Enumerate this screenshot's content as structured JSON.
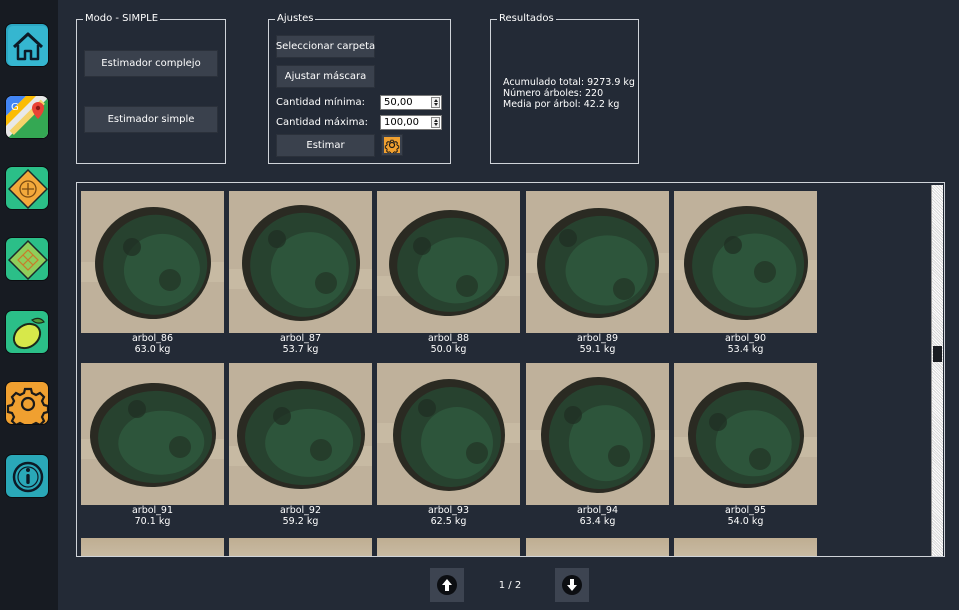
{
  "sidebar": {
    "items": [
      {
        "name": "home",
        "icon": "home-icon"
      },
      {
        "name": "maps",
        "icon": "maps-icon"
      },
      {
        "name": "add-area",
        "icon": "add-area-icon"
      },
      {
        "name": "grid-area",
        "icon": "grid-area-icon"
      },
      {
        "name": "lemon",
        "icon": "lemon-icon"
      },
      {
        "name": "settings",
        "icon": "gear-icon"
      },
      {
        "name": "info",
        "icon": "info-icon"
      }
    ]
  },
  "mode": {
    "title": "Modo - SIMPLE",
    "complex_label": "Estimador complejo",
    "simple_label": "Estimador simple"
  },
  "settings": {
    "title": "Ajustes",
    "select_folder_label": "Seleccionar carpeta",
    "adjust_mask_label": "Ajustar máscara",
    "min_label": "Cantidad mínima:",
    "min_value": "50,00",
    "max_label": "Cantidad máxima:",
    "max_value": "100,00",
    "estimate_label": "Estimar"
  },
  "results": {
    "title": "Resultados",
    "total": "Acumulado total: 9273.9 kg",
    "count": "Número árboles: 220",
    "mean": "Media por árbol: 42.2 kg"
  },
  "gallery": {
    "items": [
      {
        "name": "arbol_86",
        "weight": "63.0 kg"
      },
      {
        "name": "arbol_87",
        "weight": "53.7 kg"
      },
      {
        "name": "arbol_88",
        "weight": "50.0 kg"
      },
      {
        "name": "arbol_89",
        "weight": "59.1 kg"
      },
      {
        "name": "arbol_90",
        "weight": "53.4 kg"
      },
      {
        "name": "arbol_91",
        "weight": "70.1 kg"
      },
      {
        "name": "arbol_92",
        "weight": "59.2 kg"
      },
      {
        "name": "arbol_93",
        "weight": "62.5 kg"
      },
      {
        "name": "arbol_94",
        "weight": "63.4 kg"
      },
      {
        "name": "arbol_95",
        "weight": "54.0 kg"
      }
    ]
  },
  "pager": {
    "indicator": "1 / 2",
    "prev_icon": "arrow-up-icon",
    "next_icon": "arrow-down-icon"
  },
  "colors": {
    "background": "#232a36",
    "sidebar": "#171b22",
    "button": "#3a414d",
    "accent_teal": "#2aa8b8",
    "accent_orange": "#f0a030",
    "accent_green": "#7cc84a"
  }
}
